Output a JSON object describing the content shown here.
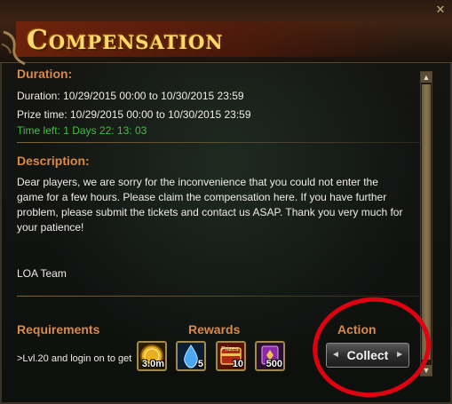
{
  "window": {
    "title": "Compensation",
    "close_glyph": "✕"
  },
  "duration": {
    "heading": "Duration:",
    "duration_line": "Duration: 10/29/2015 00:00 to 10/30/2015 23:59",
    "prize_line": "Prize time: 10/29/2015 00:00 to 10/30/2015 23:59",
    "time_left_line": "Time left: 1 Days  22: 13: 03"
  },
  "description": {
    "heading": "Description:",
    "body": "Dear players, we are sorry for the inconvenience that you could not enter the game for a few hours. Please claim the compensation here. If you have further problem, please submit the tickets and contact us ASAP. Thank you very much for your patience!",
    "signature": "LOA Team"
  },
  "bottom": {
    "requirements_heading": "Requirements",
    "rewards_heading": "Rewards",
    "action_heading": "Action",
    "requirement_text": ">Lvl.20 and login on to get",
    "collect_label": "Collect"
  },
  "rewards": [
    {
      "icon": "gold-coin-icon",
      "qty": "3.0m"
    },
    {
      "icon": "water-drop-icon",
      "qty": "5"
    },
    {
      "icon": "prizes-chest-icon",
      "label": "Prizes",
      "qty": "10"
    },
    {
      "icon": "purple-book-icon",
      "qty": "500"
    }
  ],
  "colors": {
    "section_heading": "#d88a4a",
    "title_gold": "#ffd86a",
    "time_left_green": "#3ec23e",
    "highlight_red": "#e00010"
  },
  "scrollbar": {
    "up_glyph": "▲",
    "down_glyph": "▼"
  }
}
